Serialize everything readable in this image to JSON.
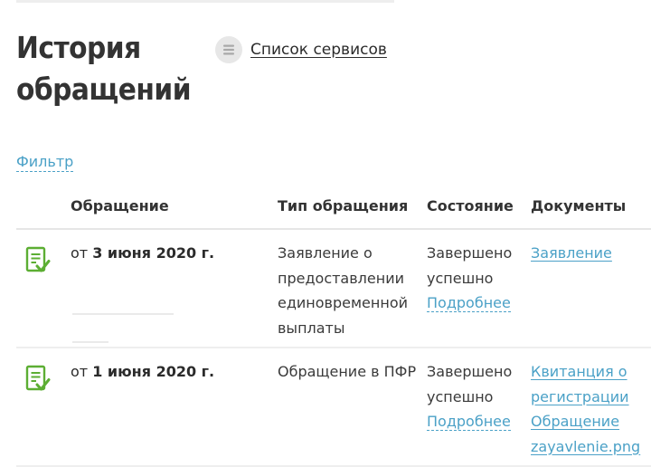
{
  "page": {
    "title_line1": "История",
    "title_line2": "обращений"
  },
  "services": {
    "label": "Список сервисов",
    "icon": "list-icon"
  },
  "filter": {
    "label": "Фильтр"
  },
  "table": {
    "headers": {
      "application": "Обращение",
      "type": "Тип обращения",
      "state": "Состояние",
      "documents": "Документы"
    },
    "rows": [
      {
        "date_prefix": "от ",
        "date": "3 июня 2020 г.",
        "type": "Заявление о предоставлении единовременной выплаты",
        "state": "Завершено успешно",
        "details_label": "Подробнее",
        "documents": [
          "Заявление"
        ]
      },
      {
        "date_prefix": "от ",
        "date": "1 июня 2020 г.",
        "type": "Обращение в ПФР",
        "state": "Завершено успешно",
        "details_label": "Подробнее",
        "documents": [
          "Квитанция о регистрации",
          "Обращение",
          "zayavlenie.png"
        ]
      }
    ]
  },
  "colors": {
    "link": "#4ba1c7",
    "icon_green": "#5cae33",
    "divider": "#e6e6e6"
  }
}
